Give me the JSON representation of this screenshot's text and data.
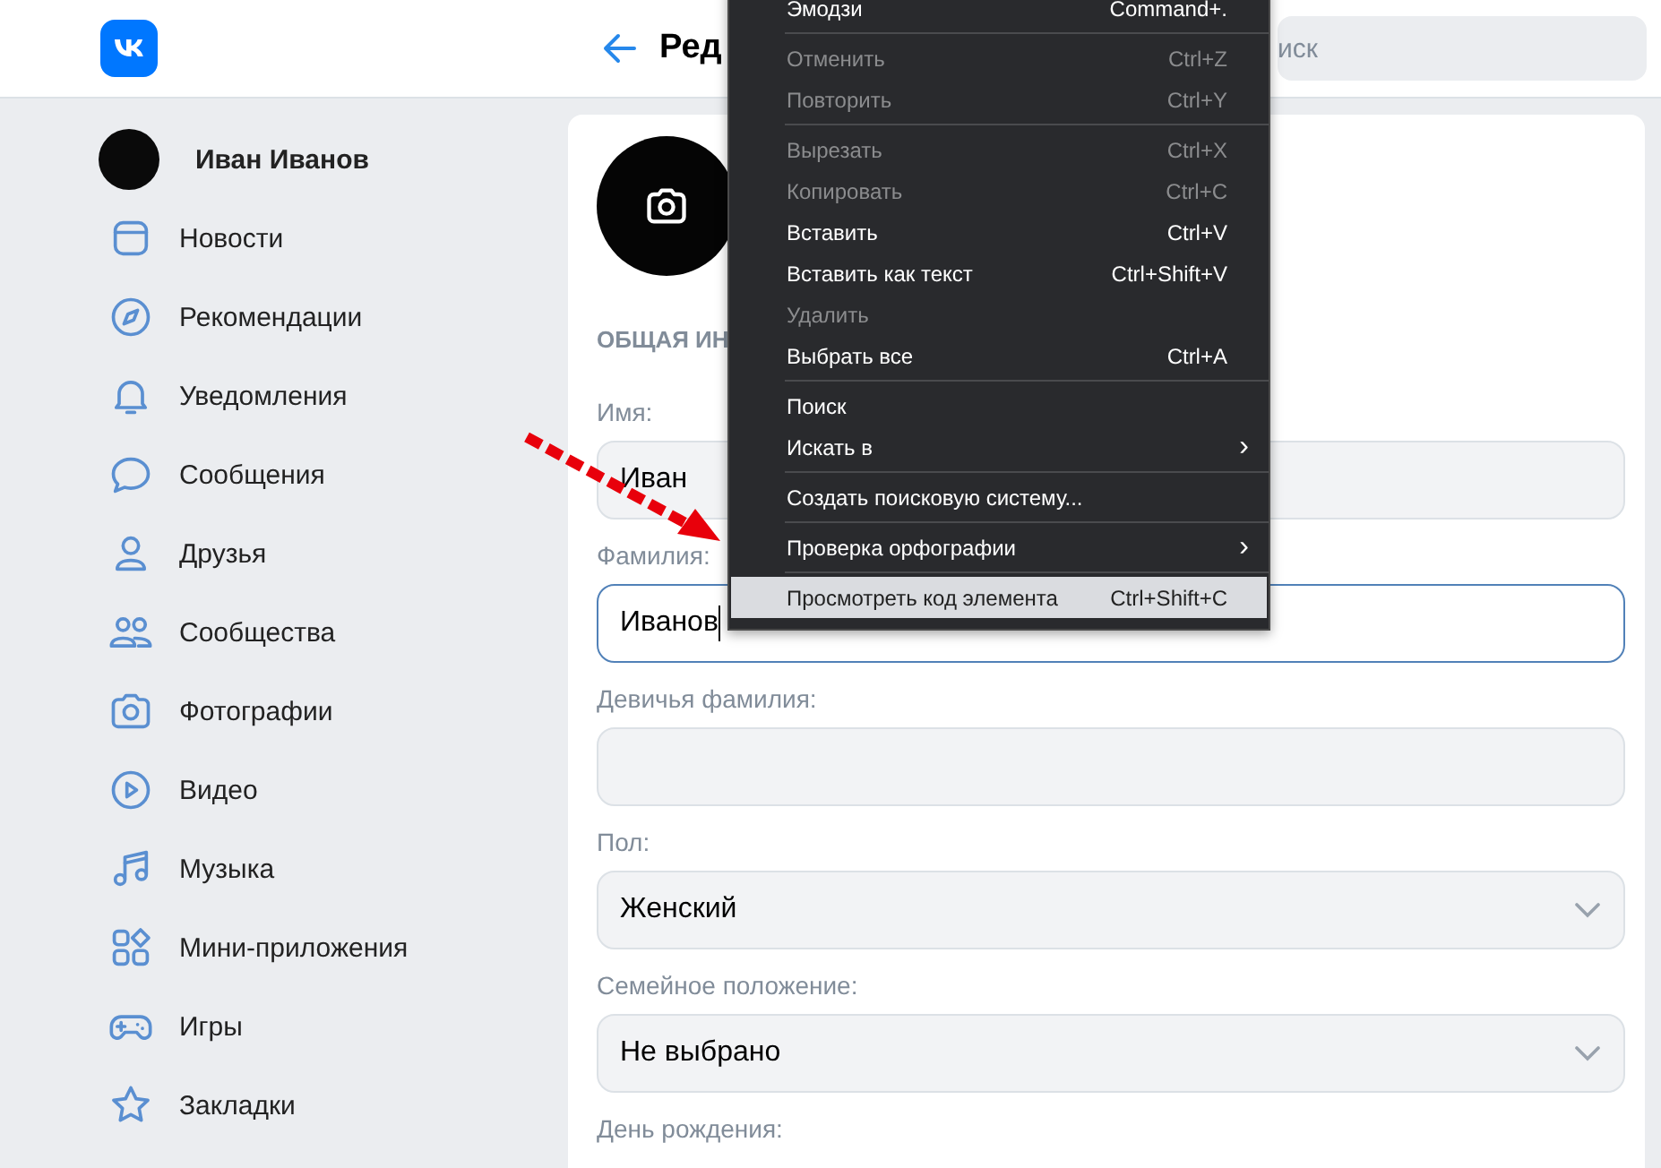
{
  "header": {
    "title": "Ред",
    "search": {
      "placeholder": "иск"
    }
  },
  "sidebar": {
    "items": [
      {
        "kind": "profile",
        "label": "Иван Иванов"
      },
      {
        "kind": "link",
        "label": "Новости"
      },
      {
        "kind": "link",
        "label": "Рекомендации"
      },
      {
        "kind": "link",
        "label": "Уведомления"
      },
      {
        "kind": "link",
        "label": "Сообщения"
      },
      {
        "kind": "link",
        "label": "Друзья"
      },
      {
        "kind": "link",
        "label": "Сообщества"
      },
      {
        "kind": "link",
        "label": "Фотографии"
      },
      {
        "kind": "link",
        "label": "Видео"
      },
      {
        "kind": "link",
        "label": "Музыка"
      },
      {
        "kind": "link",
        "label": "Мини-приложения"
      },
      {
        "kind": "link",
        "label": "Игры"
      },
      {
        "kind": "link",
        "label": "Закладки"
      }
    ]
  },
  "form": {
    "section_title": "ОБЩАЯ ИН",
    "fields": [
      {
        "kind": "text",
        "label": "Имя:",
        "value": "Иван",
        "focused": false
      },
      {
        "kind": "text",
        "label": "Фамилия:",
        "value": "Иванов",
        "focused": true
      },
      {
        "kind": "text",
        "label": "Девичья фамилия:",
        "focused": false
      },
      {
        "kind": "select",
        "label": "Пол:",
        "value": "Женский",
        "focused": false
      },
      {
        "kind": "select",
        "label": "Семейное положение:",
        "value": "Не выбрано",
        "focused": false
      },
      {
        "kind": "label",
        "label": "День рождения:"
      }
    ]
  },
  "context_menu": {
    "items": [
      {
        "kind": "item",
        "label": "Эмодзи",
        "shortcut": "Command+.",
        "disabled": false,
        "selected": false
      },
      {
        "kind": "separator"
      },
      {
        "kind": "item",
        "label": "Отменить",
        "shortcut": "Ctrl+Z",
        "disabled": true,
        "selected": false
      },
      {
        "kind": "item",
        "label": "Повторить",
        "shortcut": "Ctrl+Y",
        "disabled": true,
        "selected": false
      },
      {
        "kind": "separator"
      },
      {
        "kind": "item",
        "label": "Вырезать",
        "shortcut": "Ctrl+X",
        "disabled": true,
        "selected": false
      },
      {
        "kind": "item",
        "label": "Копировать",
        "shortcut": "Ctrl+C",
        "disabled": true,
        "selected": false
      },
      {
        "kind": "item",
        "label": "Вставить",
        "shortcut": "Ctrl+V",
        "disabled": false,
        "selected": false
      },
      {
        "kind": "item",
        "label": "Вставить как текст",
        "shortcut": "Ctrl+Shift+V",
        "disabled": false,
        "selected": false
      },
      {
        "kind": "item",
        "label": "Удалить",
        "disabled": true,
        "selected": false
      },
      {
        "kind": "item",
        "label": "Выбрать все",
        "shortcut": "Ctrl+A",
        "disabled": false,
        "selected": false
      },
      {
        "kind": "separator"
      },
      {
        "kind": "item",
        "label": "Поиск",
        "disabled": false,
        "selected": false
      },
      {
        "kind": "item",
        "label": "Искать в",
        "submenu": "›",
        "disabled": false,
        "selected": false
      },
      {
        "kind": "separator"
      },
      {
        "kind": "item",
        "label": "Создать поисковую систему...",
        "disabled": false,
        "selected": false
      },
      {
        "kind": "separator"
      },
      {
        "kind": "item",
        "label": "Проверка орфографии",
        "submenu": "›",
        "disabled": false,
        "selected": false
      },
      {
        "kind": "separator"
      },
      {
        "kind": "item",
        "label": "Просмотреть код элемента",
        "shortcut": "Ctrl+Shift+C",
        "disabled": false,
        "selected": true
      }
    ]
  }
}
